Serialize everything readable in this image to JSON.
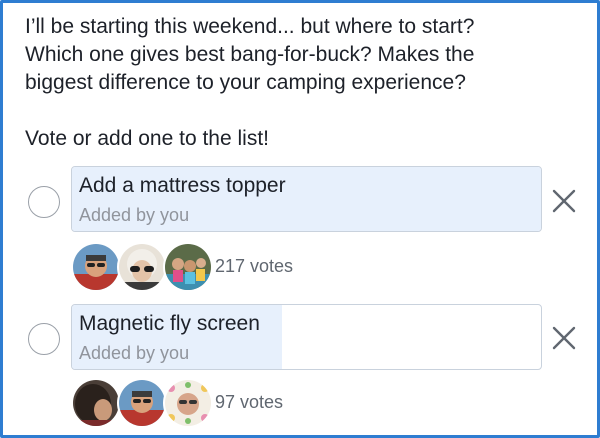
{
  "post": {
    "lines": [
      "I’ll be starting this weekend... but where to start?",
      "Which one gives best bang-for-buck? Makes the",
      "biggest difference to your camping experience?"
    ],
    "prompt": "Vote or add one to the list!"
  },
  "poll": {
    "options": [
      {
        "label": "Add a mattress topper",
        "added_by": "Added by you",
        "votes_text": "217 votes",
        "vote_share": 1.0,
        "voter_avatars": [
          "avatar-man-sunglasses",
          "avatar-woman-sunglasses",
          "avatar-kids-group"
        ]
      },
      {
        "label": "Magnetic fly screen",
        "added_by": "Added by you",
        "votes_text": "97 votes",
        "vote_share": 0.447,
        "voter_avatars": [
          "avatar-dark-hair",
          "avatar-man-sunglasses",
          "avatar-floral-frame"
        ]
      }
    ]
  },
  "colors": {
    "border_accent": "#2e7dd1",
    "option_fill": "#e7f0fc",
    "text_primary": "#1d2129",
    "text_secondary": "#90949c"
  }
}
